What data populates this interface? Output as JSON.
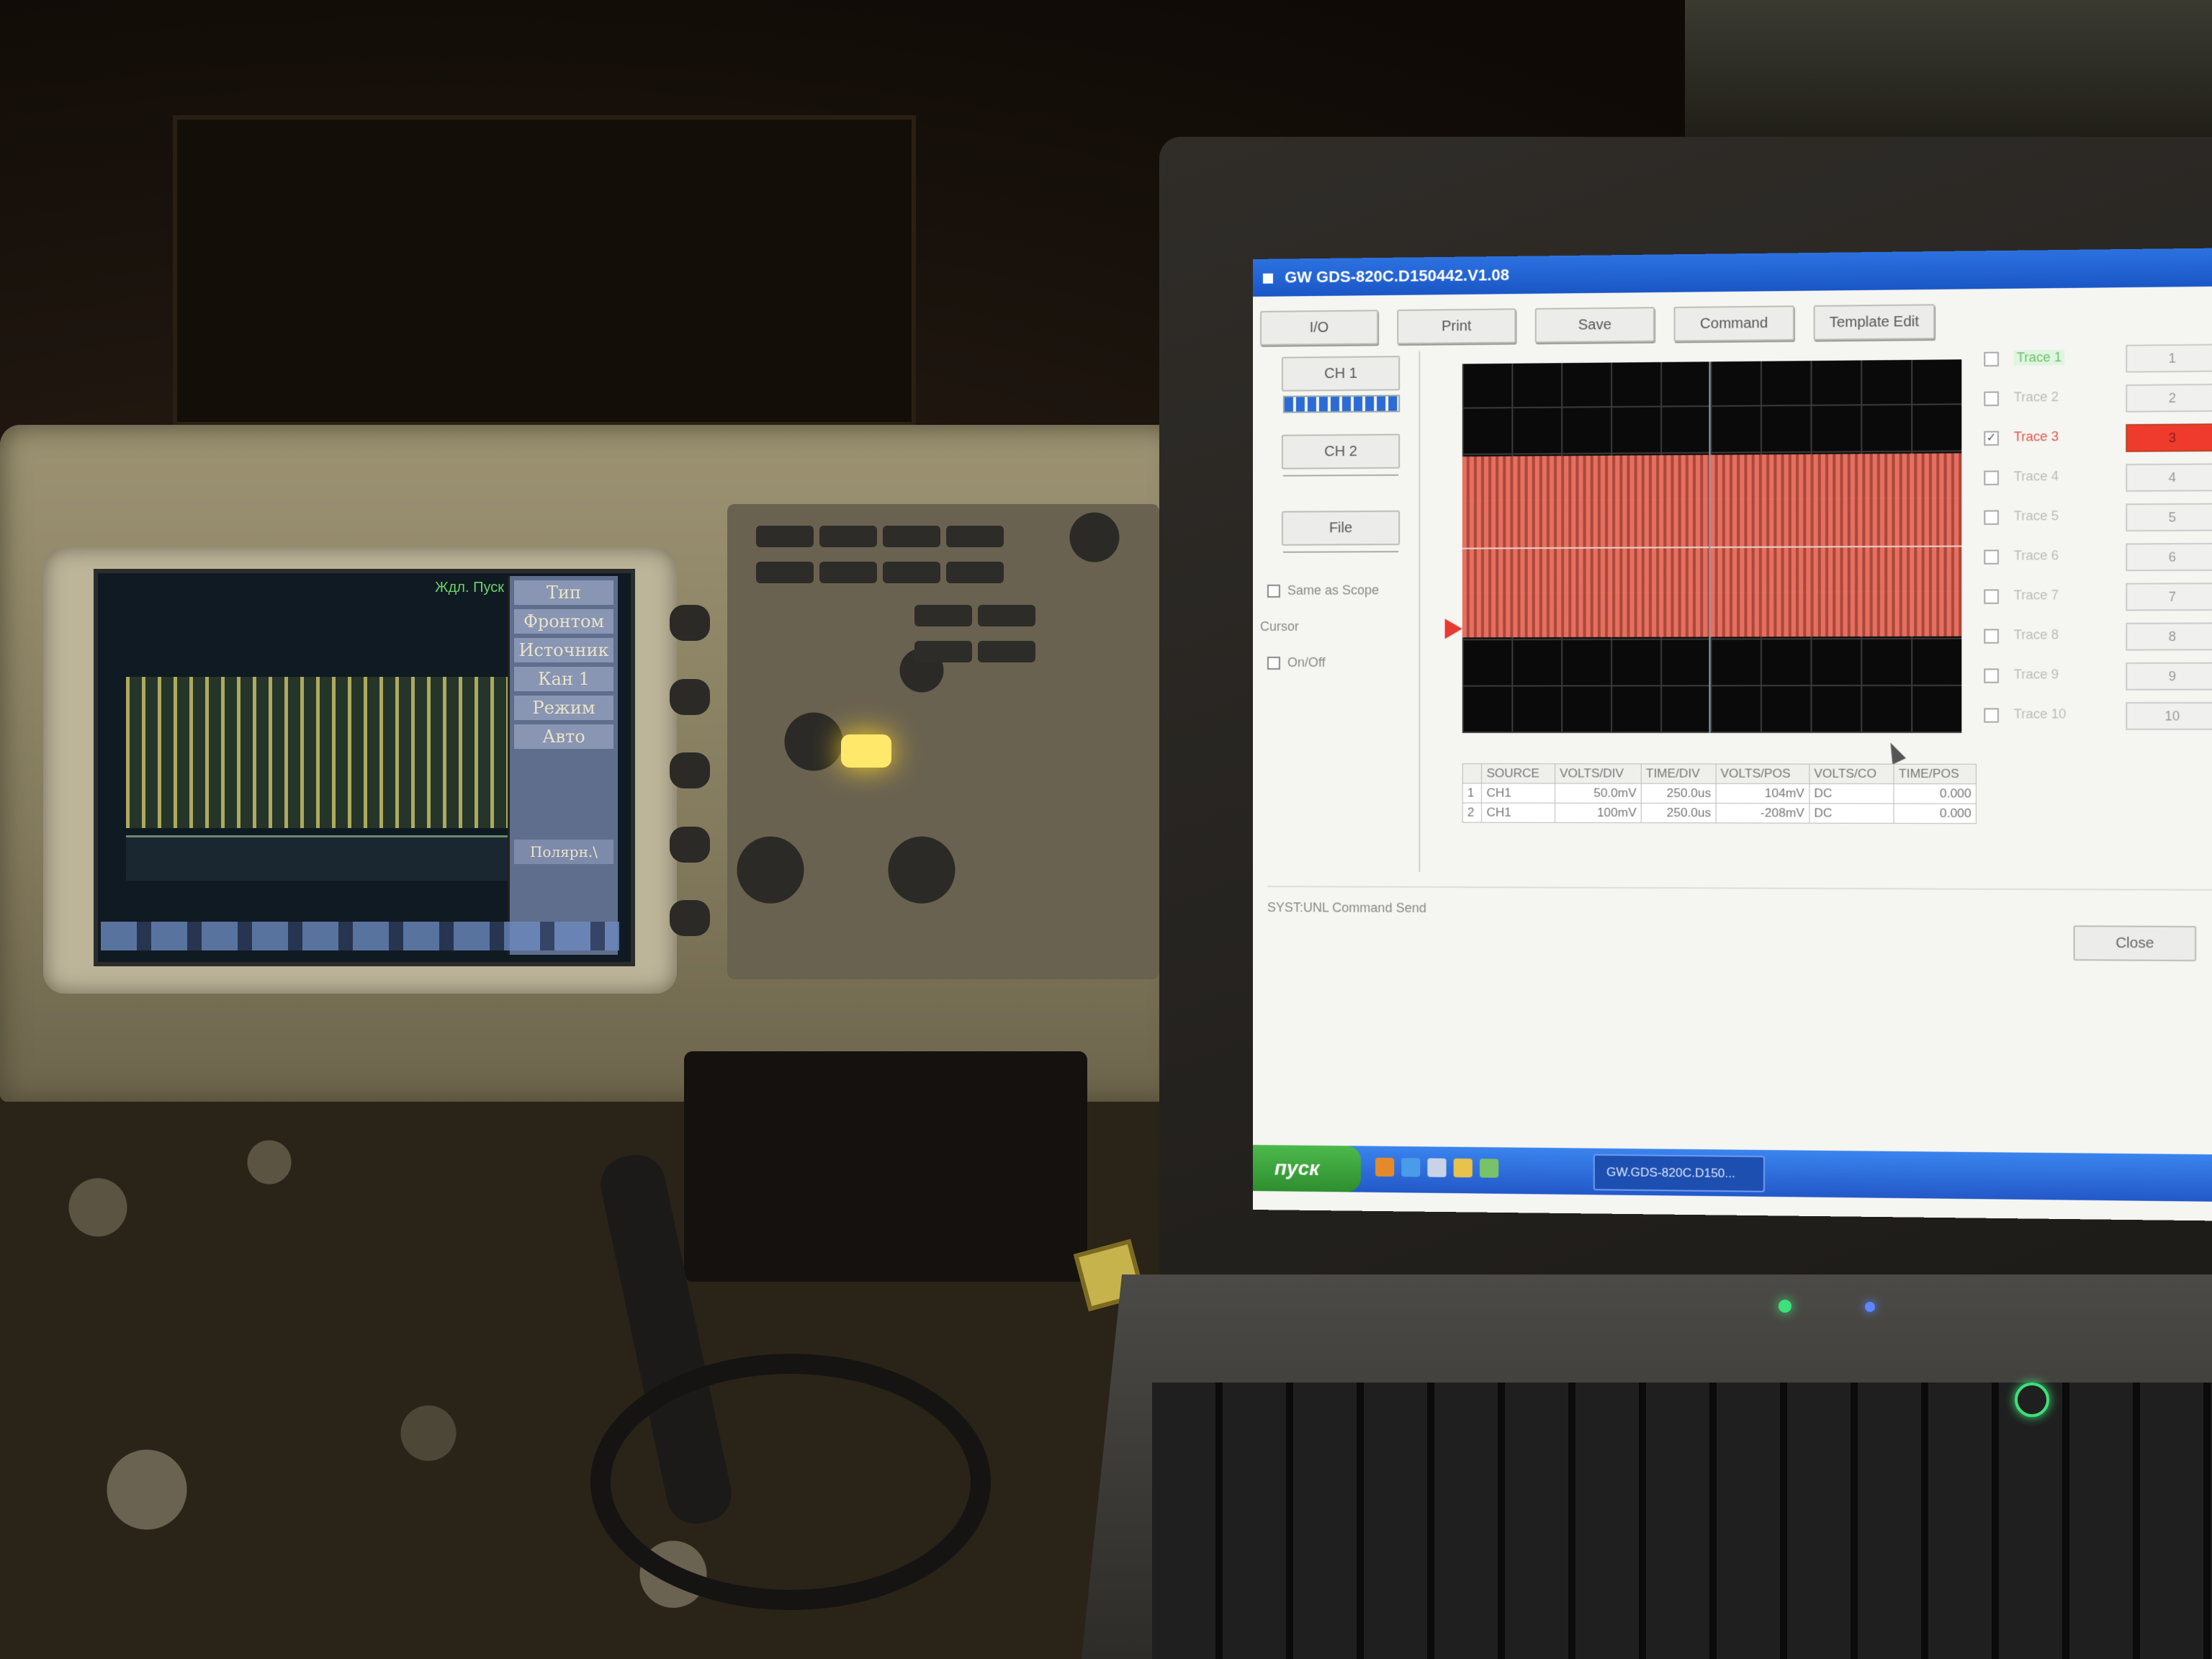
{
  "oscilloscope": {
    "status_top": "Ждл. Пуск",
    "menu_items": [
      "Тип",
      "Фронтом",
      "Источник",
      "Кан 1",
      "Режим",
      "Авто"
    ],
    "menu_bottom": "Полярн.\\"
  },
  "app": {
    "title": "GW GDS-820C.D150442.V1.08",
    "toolbar": {
      "io_label": "I/O",
      "print_label": "Print",
      "save_label": "Save",
      "command_label": "Command",
      "template_label": "Template Edit"
    },
    "left_panel": {
      "ch1_label": "CH 1",
      "ch2_label": "CH 2",
      "file_label": "File",
      "same_as_scope_label": "Same as Scope",
      "cursor_label": "Cursor",
      "onoff_label": "On/Off"
    },
    "readout": {
      "headers": [
        "",
        "SOURCE",
        "VOLTS/DIV",
        "TIME/DIV",
        "VOLTS/POS",
        "VOLTS/CO",
        "TIME/POS"
      ],
      "rows": [
        [
          "1",
          "CH1",
          "50.0mV",
          "250.0us",
          "104mV",
          "DC",
          "0.000"
        ],
        [
          "2",
          "CH1",
          "100mV",
          "250.0us",
          "-208mV",
          "DC",
          "0.000"
        ]
      ]
    },
    "traces": [
      {
        "label": "Trace 1",
        "button": "1",
        "checked": false
      },
      {
        "label": "Trace 2",
        "button": "2",
        "checked": false
      },
      {
        "label": "Trace 3",
        "button": "3",
        "checked": true
      },
      {
        "label": "Trace 4",
        "button": "4",
        "checked": false
      },
      {
        "label": "Trace 5",
        "button": "5",
        "checked": false
      },
      {
        "label": "Trace 6",
        "button": "6",
        "checked": false
      },
      {
        "label": "Trace 7",
        "button": "7",
        "checked": false
      },
      {
        "label": "Trace 8",
        "button": "8",
        "checked": false
      },
      {
        "label": "Trace 9",
        "button": "9",
        "checked": false
      },
      {
        "label": "Trace 10",
        "button": "10",
        "checked": false
      }
    ],
    "status_line": "SYST:UNL Command Send",
    "close_label": "Close",
    "waveform_color": "#f07565",
    "active_trace_color": "#ee3b2e"
  },
  "taskbar": {
    "start_label": "пуск",
    "task_item": "GW.GDS-820C.D150...",
    "title_color": "#2c71e0",
    "start_color": "#3aa83a"
  }
}
